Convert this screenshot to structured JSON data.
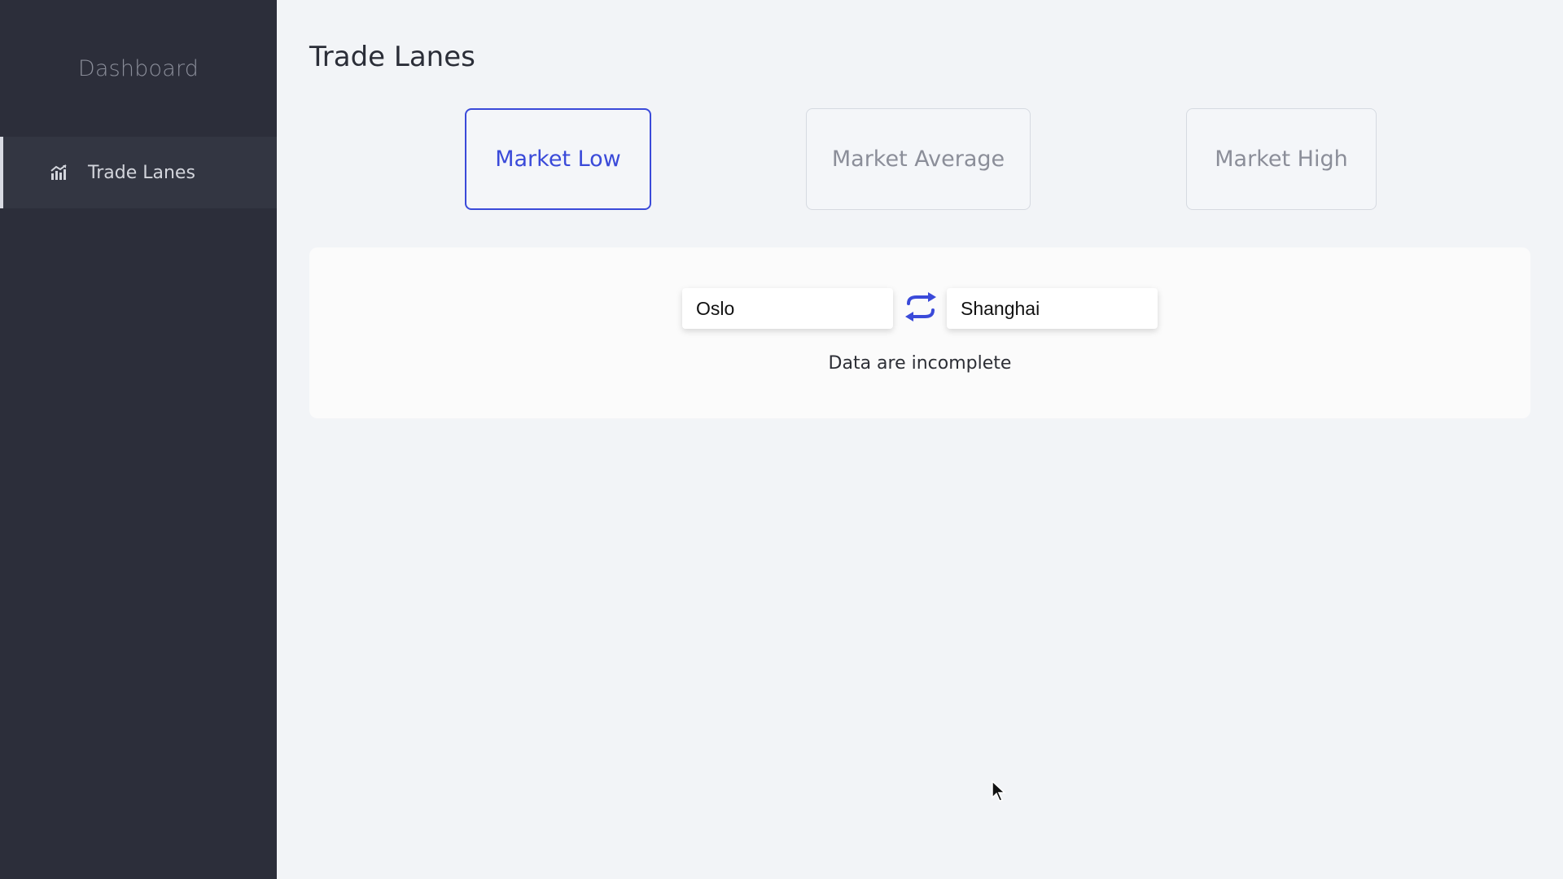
{
  "sidebar": {
    "brand": "Dashboard",
    "items": [
      {
        "label": "Trade Lanes",
        "icon": "chart-icon",
        "active": true
      }
    ]
  },
  "page": {
    "title": "Trade Lanes"
  },
  "market_toggles": [
    {
      "label": "Market Low",
      "active": true
    },
    {
      "label": "Market Average",
      "active": false
    },
    {
      "label": "Market High",
      "active": false
    }
  ],
  "route": {
    "origin": "Oslo",
    "destination": "Shanghai",
    "swap_icon": "swap-arrows-icon",
    "status": "Data are incomplete"
  },
  "colors": {
    "accent": "#3a4ad9",
    "sidebar_bg": "#2c2e3a",
    "main_bg": "#f2f4f7"
  }
}
